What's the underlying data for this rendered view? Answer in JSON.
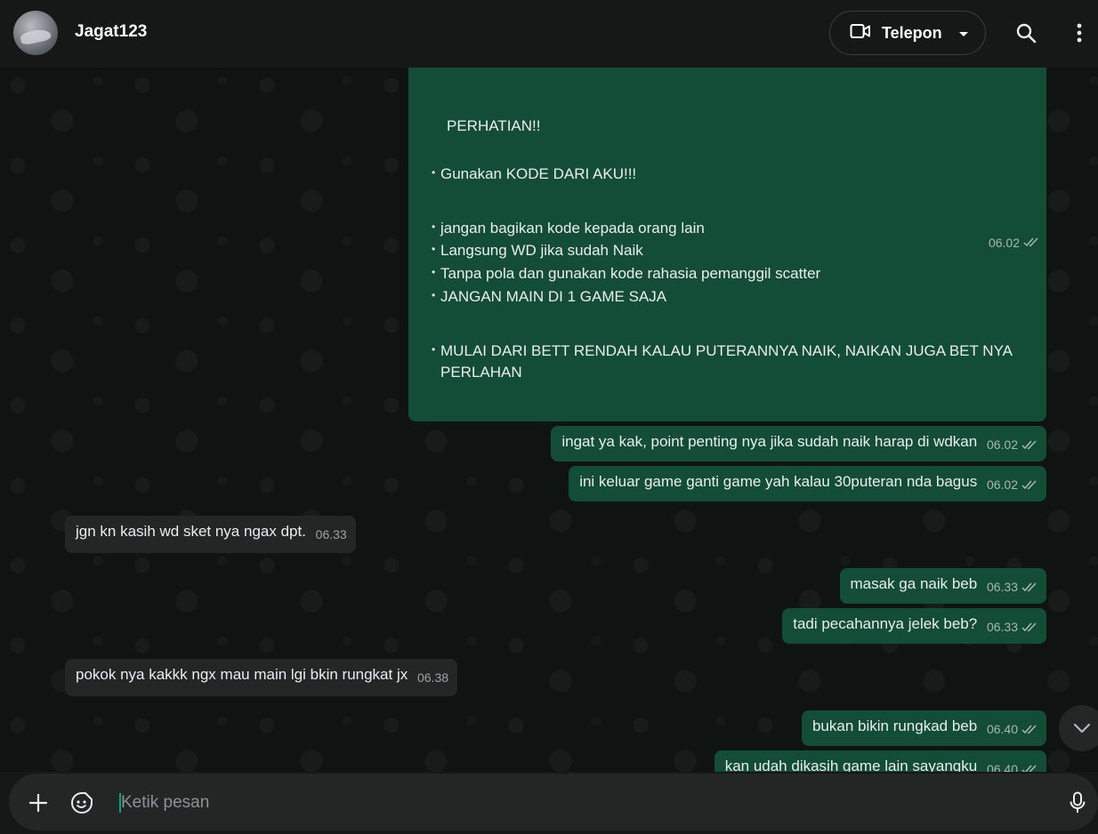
{
  "header": {
    "contact_name": "Jagat123",
    "call_label": "Telepon"
  },
  "big_message": {
    "title": "PERHATIAN!!",
    "bullets": [
      "Gunakan KODE DARI AKU!!!",
      "jangan bagikan kode kepada orang lain",
      "Langsung WD jika sudah Naik",
      "Tanpa pola dan gunakan kode rahasia pemanggil scatter",
      "JANGAN MAIN DI 1 GAME SAJA",
      "MULAI DARI BETT RENDAH KALAU PUTERANNYA NAIK, NAIKAN JUGA BET NYA",
      "PERLAHAN"
    ],
    "time": "06.02"
  },
  "messages": [
    {
      "dir": "out",
      "text": "ingat ya kak, point penting nya jika sudah naik harap di wdkan",
      "time": "06.02"
    },
    {
      "dir": "out",
      "text": "ini keluar game ganti game yah kalau 30puteran nda bagus",
      "time": "06.02"
    },
    {
      "dir": "in",
      "text": "jgn kn kasih wd sket nya ngax dpt.",
      "time": "06.33"
    },
    {
      "dir": "out",
      "text": "masak ga naik beb",
      "time": "06.33"
    },
    {
      "dir": "out",
      "text": "tadi pecahannya jelek beb?",
      "time": "06.33"
    },
    {
      "dir": "in",
      "text": "pokok nya kakkk ngx mau main lgi  bkin rungkat jx",
      "time": "06.38"
    },
    {
      "dir": "out",
      "text": "bukan bikin rungkad beb",
      "time": "06.40"
    },
    {
      "dir": "out",
      "text": "kan udah dikasih game lain sayangku",
      "time": "06.40"
    }
  ],
  "composer": {
    "placeholder": "Ketik pesan"
  },
  "colors": {
    "outgoing_bubble": "#144d37",
    "incoming_bubble": "#242626",
    "header_bg": "#161717",
    "accent": "#00a884"
  },
  "icons": [
    "video-call-icon",
    "chevron-down-icon",
    "search-icon",
    "more-vert-icon",
    "plus-icon",
    "sticker-icon",
    "mic-icon",
    "double-check-icon"
  ]
}
